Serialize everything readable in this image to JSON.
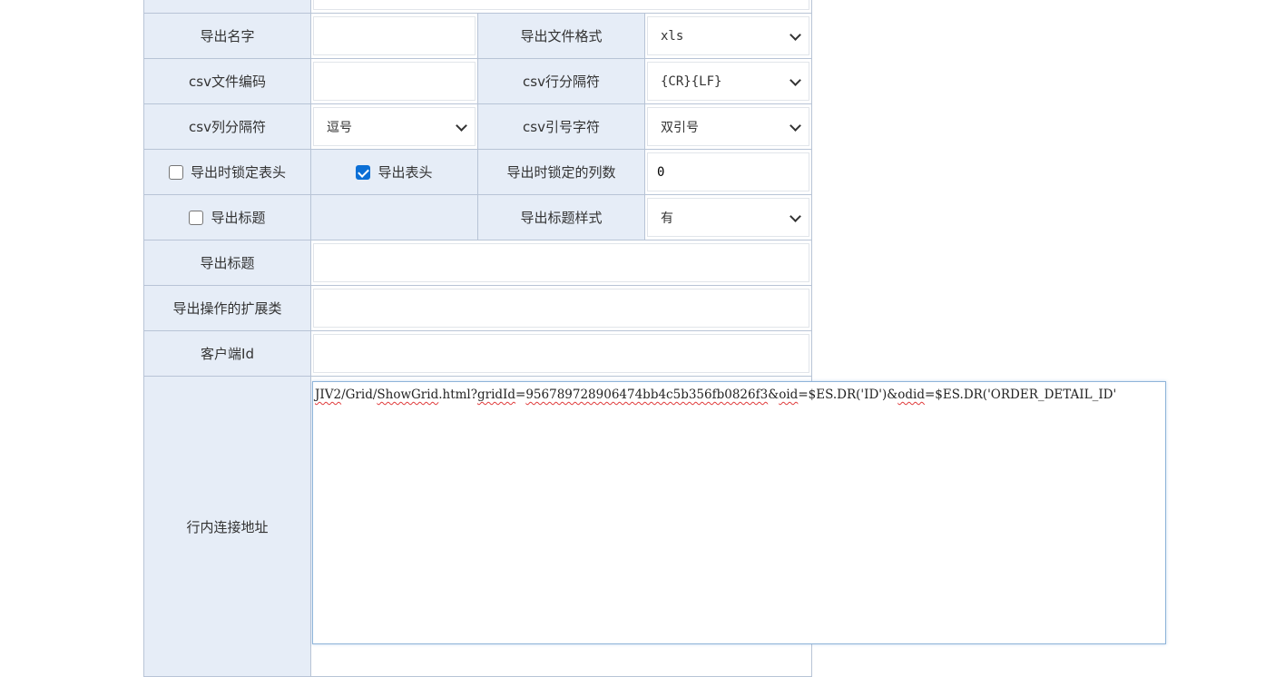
{
  "form": {
    "rows": {
      "export_name": {
        "label": "导出名字",
        "value": ""
      },
      "export_format": {
        "label": "导出文件格式",
        "selected": "xls"
      },
      "csv_encoding": {
        "label": "csv文件编码",
        "value": ""
      },
      "csv_row_sep": {
        "label": "csv行分隔符",
        "selected": "{CR}{LF}"
      },
      "csv_col_sep": {
        "label": "csv列分隔符",
        "selected": "逗号"
      },
      "csv_quote": {
        "label": "csv引号字符",
        "selected": "双引号"
      },
      "lock_header": {
        "label": "导出时锁定表头",
        "checked": false
      },
      "export_header": {
        "label": "导出表头",
        "checked": true
      },
      "locked_cols": {
        "label": "导出时锁定的列数",
        "value": "0"
      },
      "export_title_chk": {
        "label": "导出标题",
        "checked": false
      },
      "title_style": {
        "label": "导出标题样式",
        "selected": "有"
      },
      "export_title": {
        "label": "导出标题",
        "value": ""
      },
      "ext_class": {
        "label": "导出操作的扩展类",
        "value": ""
      },
      "client_id": {
        "label": "客户端Id",
        "value": ""
      },
      "row_link": {
        "label": "行内连接地址",
        "url_parts": {
          "a": "JIV2",
          "b": "/Grid/",
          "c": "ShowGrid",
          "d": ".html?",
          "e": "gridId",
          "f": "=",
          "g": "956789728906474bb4c5b356fb0826f3",
          "h": "&",
          "i": "oid",
          "j": "=$ES.DR('ID')&",
          "k": "odid",
          "l": "=$ES.DR('ORDER_DETAIL_ID'"
        }
      }
    }
  },
  "colors": {
    "label_bg": "#e6edf7",
    "border": "#b8c4d6",
    "checkbox_checked": "#0b6fd6"
  },
  "icons": {
    "select_arrow": "chevron-down-icon",
    "checkbox_tick": "check-icon"
  }
}
